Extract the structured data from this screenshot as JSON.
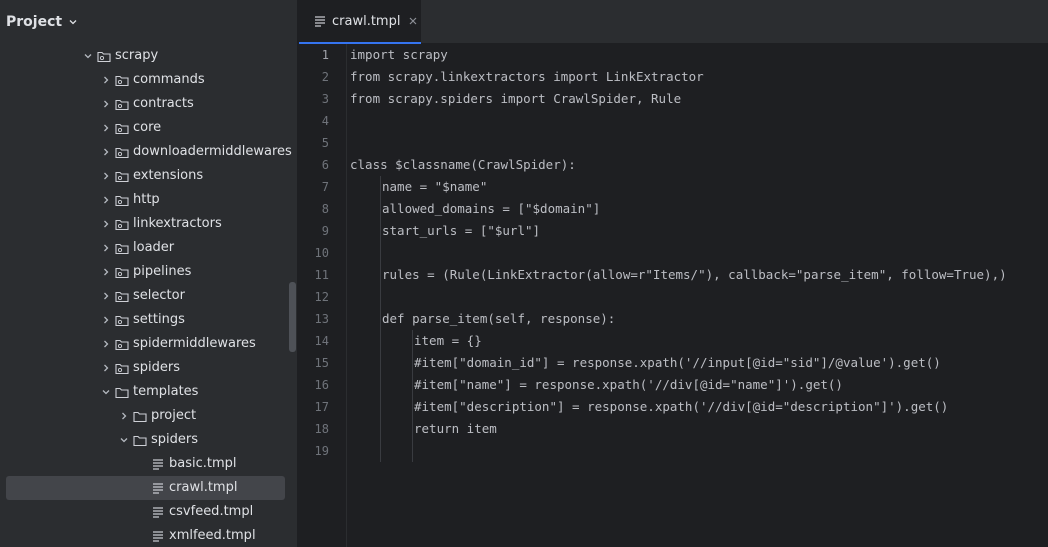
{
  "project_panel": {
    "title": "Project",
    "tree": [
      {
        "label": "scrapy",
        "depth": 0,
        "expanded": true,
        "icon": "folder-package-icon"
      },
      {
        "label": "commands",
        "depth": 1,
        "expanded": false,
        "icon": "folder-package-icon"
      },
      {
        "label": "contracts",
        "depth": 1,
        "expanded": false,
        "icon": "folder-package-icon"
      },
      {
        "label": "core",
        "depth": 1,
        "expanded": false,
        "icon": "folder-package-icon"
      },
      {
        "label": "downloadermiddlewares",
        "depth": 1,
        "expanded": false,
        "icon": "folder-package-icon"
      },
      {
        "label": "extensions",
        "depth": 1,
        "expanded": false,
        "icon": "folder-package-icon"
      },
      {
        "label": "http",
        "depth": 1,
        "expanded": false,
        "icon": "folder-package-icon"
      },
      {
        "label": "linkextractors",
        "depth": 1,
        "expanded": false,
        "icon": "folder-package-icon"
      },
      {
        "label": "loader",
        "depth": 1,
        "expanded": false,
        "icon": "folder-package-icon"
      },
      {
        "label": "pipelines",
        "depth": 1,
        "expanded": false,
        "icon": "folder-package-icon"
      },
      {
        "label": "selector",
        "depth": 1,
        "expanded": false,
        "icon": "folder-package-icon"
      },
      {
        "label": "settings",
        "depth": 1,
        "expanded": false,
        "icon": "folder-package-icon"
      },
      {
        "label": "spidermiddlewares",
        "depth": 1,
        "expanded": false,
        "icon": "folder-package-icon"
      },
      {
        "label": "spiders",
        "depth": 1,
        "expanded": false,
        "icon": "folder-package-icon"
      },
      {
        "label": "templates",
        "depth": 1,
        "expanded": true,
        "icon": "folder-icon"
      },
      {
        "label": "project",
        "depth": 2,
        "expanded": false,
        "icon": "folder-icon"
      },
      {
        "label": "spiders",
        "depth": 2,
        "expanded": true,
        "icon": "folder-icon"
      },
      {
        "label": "basic.tmpl",
        "depth": 3,
        "file": true,
        "icon": "text-file-icon"
      },
      {
        "label": "crawl.tmpl",
        "depth": 3,
        "file": true,
        "selected": true,
        "icon": "text-file-icon"
      },
      {
        "label": "csvfeed.tmpl",
        "depth": 3,
        "file": true,
        "icon": "text-file-icon"
      },
      {
        "label": "xmlfeed.tmpl",
        "depth": 3,
        "file": true,
        "icon": "text-file-icon"
      }
    ]
  },
  "editor": {
    "tab": {
      "label": "crawl.tmpl",
      "icon": "text-file-icon"
    },
    "current_line": 1,
    "lines": [
      {
        "n": "1",
        "indent": 0,
        "text": "import scrapy"
      },
      {
        "n": "2",
        "indent": 0,
        "text": "from scrapy.linkextractors import LinkExtractor"
      },
      {
        "n": "3",
        "indent": 0,
        "text": "from scrapy.spiders import CrawlSpider, Rule"
      },
      {
        "n": "4",
        "indent": 0,
        "text": ""
      },
      {
        "n": "5",
        "indent": 0,
        "text": ""
      },
      {
        "n": "6",
        "indent": 0,
        "text": "class $classname(CrawlSpider):"
      },
      {
        "n": "7",
        "indent": 1,
        "text": "name = \"$name\""
      },
      {
        "n": "8",
        "indent": 1,
        "text": "allowed_domains = [\"$domain\"]"
      },
      {
        "n": "9",
        "indent": 1,
        "text": "start_urls = [\"$url\"]"
      },
      {
        "n": "10",
        "indent": 0,
        "text": ""
      },
      {
        "n": "11",
        "indent": 1,
        "text": "rules = (Rule(LinkExtractor(allow=r\"Items/\"), callback=\"parse_item\", follow=True),)"
      },
      {
        "n": "12",
        "indent": 0,
        "text": ""
      },
      {
        "n": "13",
        "indent": 1,
        "text": "def parse_item(self, response):"
      },
      {
        "n": "14",
        "indent": 2,
        "text": "item = {}"
      },
      {
        "n": "15",
        "indent": 2,
        "text": "#item[\"domain_id\"] = response.xpath('//input[@id=\"sid\"]/@value').get()"
      },
      {
        "n": "16",
        "indent": 2,
        "text": "#item[\"name\"] = response.xpath('//div[@id=\"name\"]').get()"
      },
      {
        "n": "17",
        "indent": 2,
        "text": "#item[\"description\"] = response.xpath('//div[@id=\"description\"]').get()"
      },
      {
        "n": "18",
        "indent": 2,
        "text": "return item"
      },
      {
        "n": "19",
        "indent": 0,
        "text": ""
      }
    ]
  },
  "colors": {
    "panel_bg": "#2b2d30",
    "editor_bg": "#1e1f22",
    "selection": "#43454a",
    "accent": "#3574f0"
  }
}
